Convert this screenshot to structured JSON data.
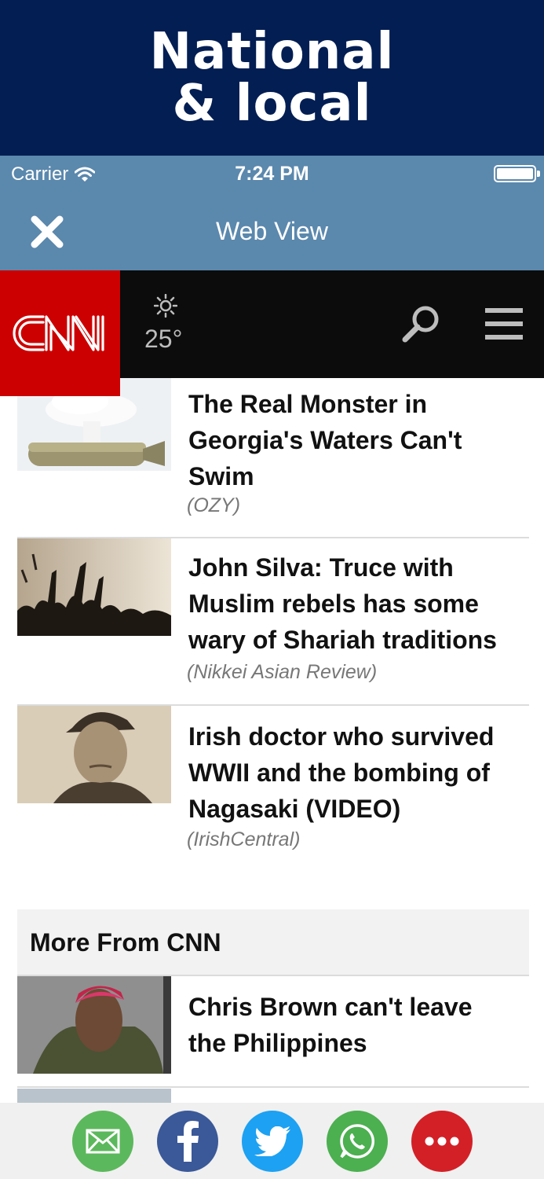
{
  "promo": {
    "line1": "National",
    "line2": "& local"
  },
  "status_bar": {
    "carrier": "Carrier",
    "time": "7:24 PM"
  },
  "nav": {
    "title": "Web View"
  },
  "cnn_header": {
    "logo_text": "CNN",
    "temperature": "25°",
    "weather_icon": "sun-icon"
  },
  "articles": [
    {
      "title": "The Real Monster in Georgia's Waters Can't Swim",
      "title_lines": [
        "The Real Monster in",
        "Georgia's Waters Can't",
        "Swim"
      ],
      "source": "(OZY)"
    },
    {
      "title": "John Silva: Truce with Muslim rebels has some wary of Shariah traditions",
      "title_lines": [
        "John Silva: Truce with",
        "Muslim rebels has some",
        "wary of Shariah traditions"
      ],
      "source": "(Nikkei Asian Review)"
    },
    {
      "title": "Irish doctor who survived WWII and the bombing of Nagasaki (VIDEO)",
      "title_lines": [
        "Irish doctor who survived",
        "WWII and the bombing of",
        "Nagasaki (VIDEO)"
      ],
      "source": "(IrishCentral)"
    }
  ],
  "more_section": {
    "title": "More From CNN",
    "items": [
      {
        "title": "Chris Brown can't leave the Philippines",
        "title_lines": [
          "Chris Brown can't leave",
          "the Philippines"
        ]
      }
    ]
  },
  "share": [
    {
      "name": "email",
      "color": "#5cb85c"
    },
    {
      "name": "facebook",
      "color": "#3b5998"
    },
    {
      "name": "twitter",
      "color": "#1da1f2"
    },
    {
      "name": "whatsapp",
      "color": "#4caf50"
    },
    {
      "name": "more",
      "color": "#d32027"
    }
  ],
  "colors": {
    "promo_bg": "#021e53",
    "nav_bg": "#5b88ad",
    "cnn_red": "#cc0000",
    "cnn_black": "#0c0c0c"
  }
}
